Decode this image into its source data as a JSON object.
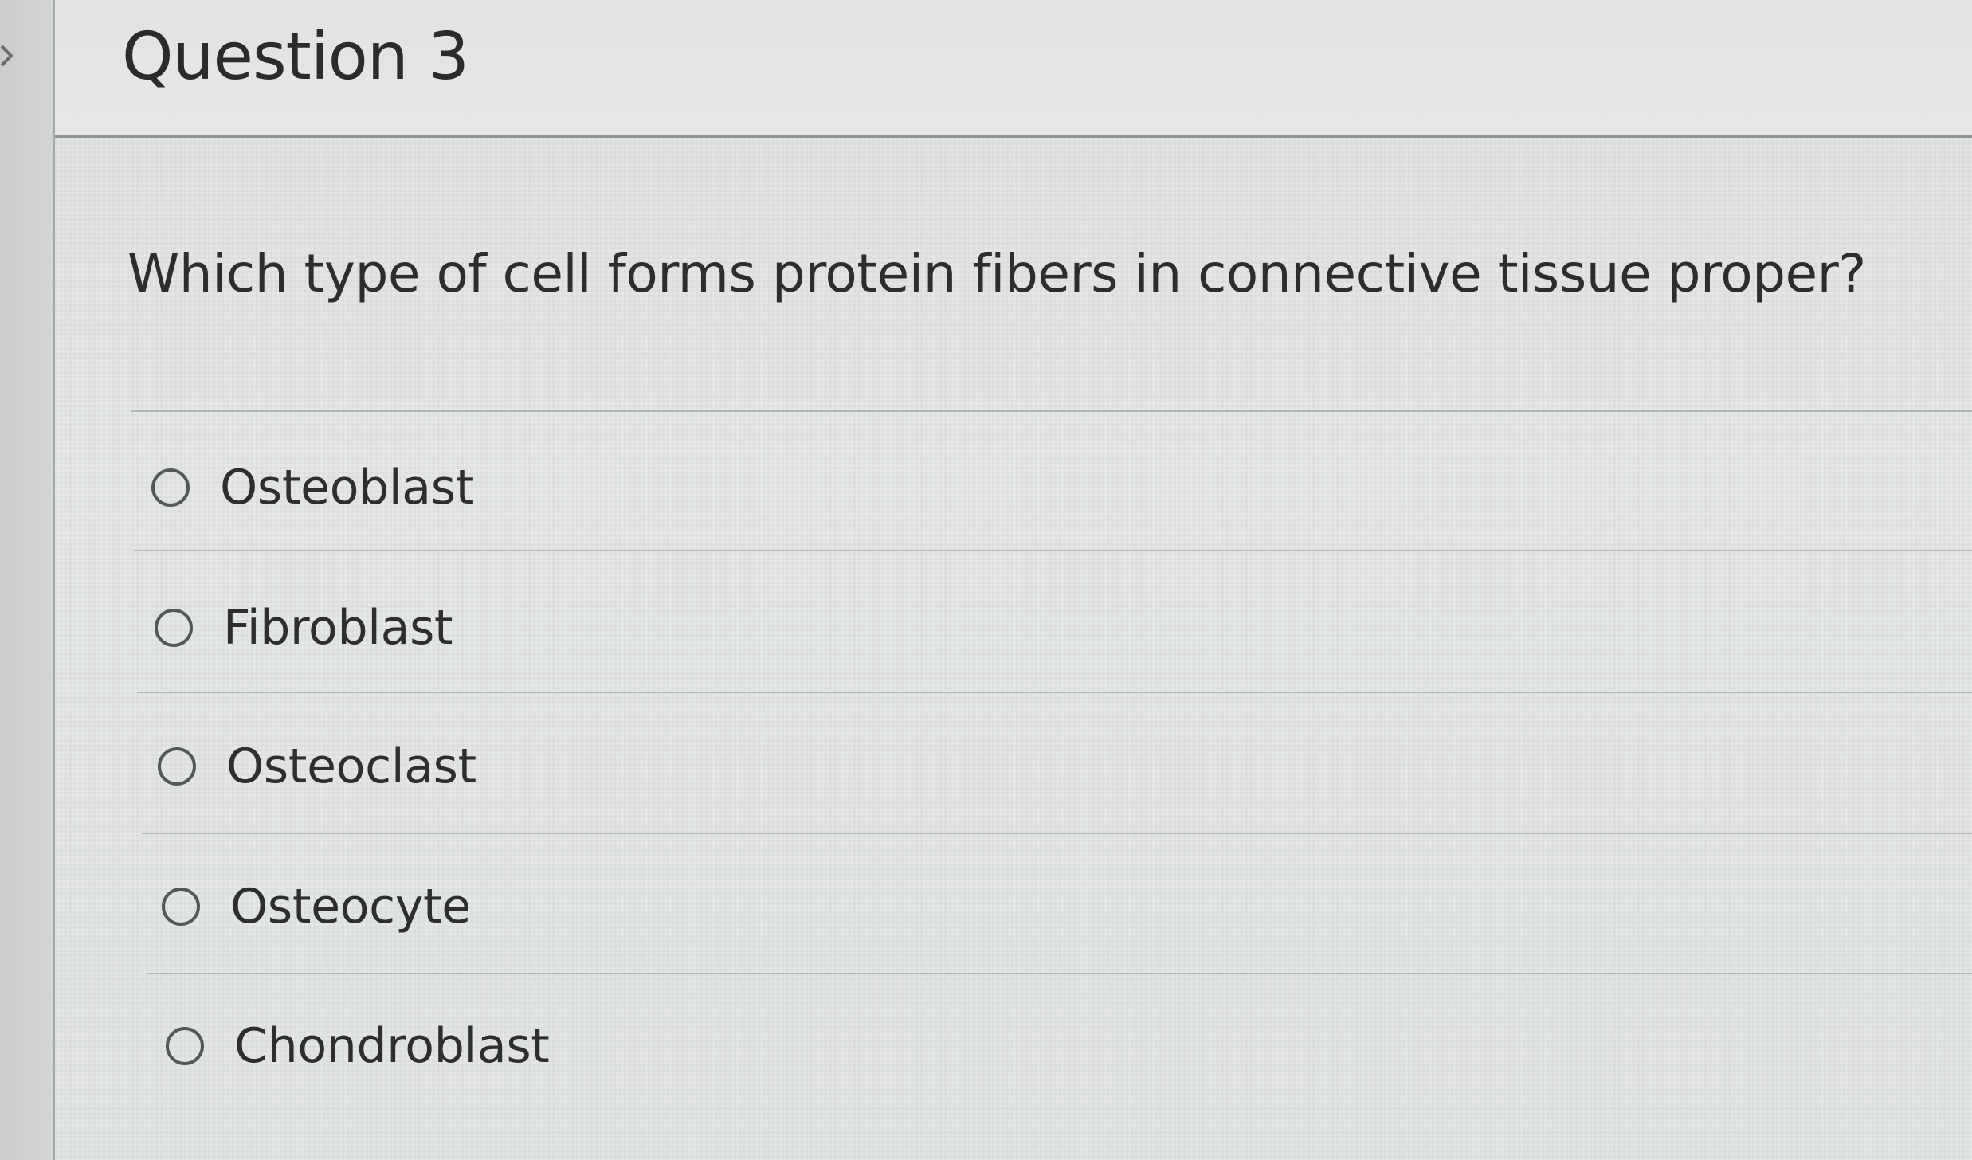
{
  "question": {
    "title": "Question 3",
    "prompt": "Which type of cell forms protein fibers in connective tissue proper?",
    "options": [
      {
        "label": "Osteoblast",
        "selected": false
      },
      {
        "label": "Fibroblast",
        "selected": false
      },
      {
        "label": "Osteoclast",
        "selected": false
      },
      {
        "label": "Osteocyte",
        "selected": false
      },
      {
        "label": "Chondroblast",
        "selected": false
      }
    ]
  },
  "icons": {
    "sidebar_toggle": "chevron-right-icon",
    "option_control": "radio-button-icon"
  }
}
